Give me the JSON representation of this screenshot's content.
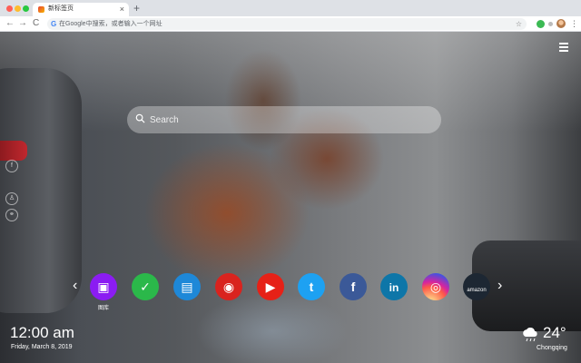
{
  "browser": {
    "tab_title": "新标签页",
    "tab_close": "×",
    "new_tab": "+",
    "back": "←",
    "forward": "→",
    "reload": "C",
    "omnibox_prefix": "G",
    "omnibox_placeholder": "在Google中搜索，或者输入一个网址",
    "bookmark_star": "☆",
    "menu": "⋮",
    "traffic_colors": [
      "#ff5f57",
      "#febc2e",
      "#28c840"
    ]
  },
  "search": {
    "placeholder": "Search"
  },
  "sidebar": {
    "icons": [
      {
        "name": "facebook-share-icon",
        "glyph": "f"
      },
      {
        "name": "user-icon",
        "glyph": "♙"
      },
      {
        "name": "link-icon",
        "glyph": "⚭"
      }
    ]
  },
  "apps": [
    {
      "name": "gallery",
      "icon": "gallery-icon",
      "glyph": "▣",
      "color": "#8b1cf2",
      "label": "图库"
    },
    {
      "name": "check",
      "icon": "check-icon",
      "glyph": "✓",
      "color": "#2bb84a",
      "label": ""
    },
    {
      "name": "news",
      "icon": "news-icon",
      "glyph": "▤",
      "color": "#1e88d8",
      "label": ""
    },
    {
      "name": "game",
      "icon": "game-icon",
      "glyph": "◉",
      "color": "#d9231e",
      "label": ""
    },
    {
      "name": "youtube",
      "icon": "youtube-icon",
      "glyph": "▶",
      "color": "#e62117",
      "label": ""
    },
    {
      "name": "twitter",
      "icon": "twitter-icon",
      "glyph": "t",
      "color": "#1da1f2",
      "label": ""
    },
    {
      "name": "facebook",
      "icon": "facebook-icon",
      "glyph": "f",
      "color": "#3b5998",
      "label": ""
    },
    {
      "name": "linkedin",
      "icon": "linkedin-icon",
      "glyph": "in",
      "color": "#0e76a8",
      "label": ""
    },
    {
      "name": "instagram",
      "icon": "instagram-icon",
      "glyph": "◎",
      "color": "#d6249f",
      "label": ""
    },
    {
      "name": "amazon",
      "icon": "amazon-icon",
      "glyph": "amazon",
      "color": "#1d2733",
      "label": ""
    }
  ],
  "nav": {
    "prev": "‹",
    "next": "›"
  },
  "clock": {
    "time": "12:00 am",
    "date": "Friday, March 8, 2019"
  },
  "weather": {
    "temperature": "24°",
    "city": "Chongqing",
    "condition": "cloud-rain"
  }
}
